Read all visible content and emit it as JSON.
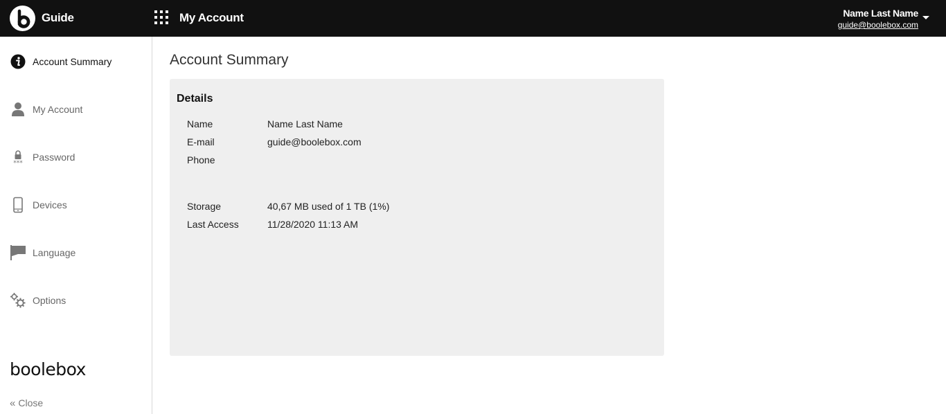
{
  "header": {
    "app_name": "Guide",
    "section_title": "My Account",
    "user_name": "Name Last Name",
    "user_email": "guide@boolebox.com",
    "logo_icon": "boolebox-b-logo",
    "apps_icon": "apps-grid-icon"
  },
  "sidebar": {
    "items": [
      {
        "label": "Account Summary",
        "icon": "info-icon",
        "active": true
      },
      {
        "label": "My Account",
        "icon": "user-icon",
        "active": false
      },
      {
        "label": "Password",
        "icon": "lock-icon",
        "active": false
      },
      {
        "label": "Devices",
        "icon": "phone-icon",
        "active": false
      },
      {
        "label": "Language",
        "icon": "flag-icon",
        "active": false
      },
      {
        "label": "Options",
        "icon": "gears-icon",
        "active": false
      }
    ],
    "brand": "boolebox",
    "close_label": "Close"
  },
  "main": {
    "title": "Account Summary",
    "details": {
      "title": "Details",
      "rows": [
        {
          "label": "Name",
          "value": "Name Last Name"
        },
        {
          "label": "E-mail",
          "value": "guide@boolebox.com"
        },
        {
          "label": "Phone",
          "value": ""
        },
        {
          "label": "Storage",
          "value": "40,67 MB used of 1 TB (1%)"
        },
        {
          "label": "Last Access",
          "value": "11/28/2020 11:13 AM"
        }
      ]
    }
  },
  "colors": {
    "topbar": "#111111",
    "panel_bg": "#efefef",
    "active_text": "#111111",
    "inactive_text": "#666666"
  }
}
